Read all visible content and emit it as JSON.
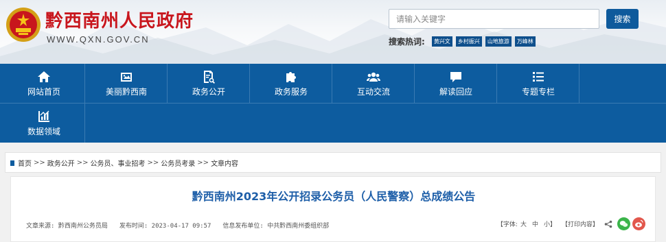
{
  "header": {
    "site_title": "黔西南州人民政府",
    "site_url": "WWW.QXN.GOV.CN",
    "search": {
      "placeholder": "请输入关键字",
      "button_label": "搜索"
    },
    "hot_search": {
      "label": "搜索热词:",
      "tags": [
        "黄兴文",
        "乡村振兴",
        "山地旅游",
        "万峰林"
      ]
    }
  },
  "nav": {
    "items": [
      {
        "label": "网站首页",
        "icon": "home-icon"
      },
      {
        "label": "美丽黔西南",
        "icon": "image-card-icon"
      },
      {
        "label": "政务公开",
        "icon": "document-search-icon"
      },
      {
        "label": "政务服务",
        "icon": "puzzle-icon"
      },
      {
        "label": "互动交流",
        "icon": "people-icon"
      },
      {
        "label": "解读回应",
        "icon": "chat-icon"
      },
      {
        "label": "专题专栏",
        "icon": "list-icon"
      },
      {
        "label": "数据领域",
        "icon": "chart-icon"
      }
    ]
  },
  "breadcrumb": {
    "items": [
      "首页",
      "政务公开",
      "公务员、事业招考",
      "公务员考录",
      "文章内容"
    ],
    "separator": ">>"
  },
  "article": {
    "title": "黔西南州2023年公开招录公务员（人民警察）总成绩公告",
    "source": "文章来源: 黔西南州公务员局",
    "publish_time": "发布时间: 2023-04-17 09:57",
    "publisher": "信息发布单位: 中共黔西南州委组织部",
    "font_label": "【字体:",
    "font_large": "大",
    "font_medium": "中",
    "font_small": "小】",
    "print_label": "【打印内容】"
  },
  "colors": {
    "nav_blue": "#0d5c9f",
    "title_red": "#c8161d",
    "article_title_blue": "#1d5ea8",
    "wechat_green": "#3bb44a",
    "weibo_red": "#e2574c"
  }
}
